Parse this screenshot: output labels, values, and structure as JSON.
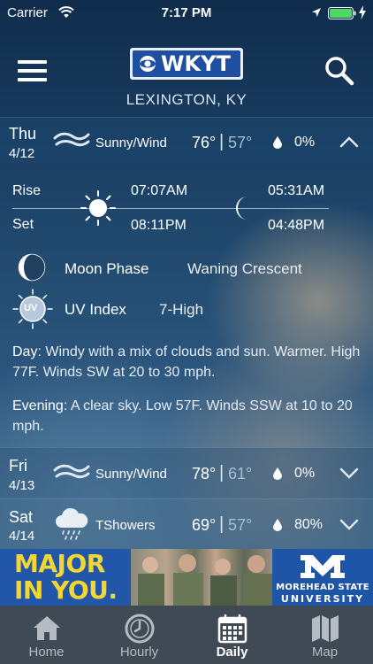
{
  "status_bar": {
    "carrier": "Carrier",
    "time": "7:17 PM",
    "battery_color": "#4cd964"
  },
  "header": {
    "logo_text": "WKYT",
    "location": "LEXINGTON, KY",
    "menu_icon": "hamburger-menu-icon",
    "search_icon": "search-icon"
  },
  "days": [
    {
      "name": "Thu",
      "date": "4/12",
      "condition": "Sunny/Wind",
      "icon": "wind-icon",
      "high": "76°",
      "separator": "|",
      "low": "57°",
      "precip": "0%",
      "expanded": true
    },
    {
      "name": "Fri",
      "date": "4/13",
      "condition": "Sunny/Wind",
      "icon": "wind-icon",
      "high": "78°",
      "separator": "|",
      "low": "61°",
      "precip": "0%",
      "expanded": false
    },
    {
      "name": "Sat",
      "date": "4/14",
      "condition": "TShowers",
      "icon": "rain-cloud-icon",
      "high": "69°",
      "separator": "|",
      "low": "57°",
      "precip": "80%",
      "expanded": false
    }
  ],
  "details": {
    "rise_label": "Rise",
    "set_label": "Set",
    "sunrise": "07:07AM",
    "sunset": "08:11PM",
    "moonrise": "05:31AM",
    "moonset": "04:48PM",
    "moon_phase_label": "Moon Phase",
    "moon_phase_value": "Waning Crescent",
    "uv_label": "UV Index",
    "uv_value": "7-High",
    "uv_badge": "UV",
    "day_label": "Day",
    "day_text": ": Windy with a mix of clouds and sun. Warmer. High 77F. Winds SW at 20 to 30 mph.",
    "evening_label": "Evening",
    "evening_text": ": A clear sky. Low 57F. Winds SSW at 10 to 20 mph."
  },
  "ad": {
    "headline_line1": "MAJOR",
    "headline_line2": "IN YOU.",
    "university_line1": "MOREHEAD STATE",
    "university_line2": "UNIVERSITY",
    "headline_color": "#f4d633",
    "background_color": "#2156a8"
  },
  "tabs": [
    {
      "label": "Home",
      "icon": "home-icon",
      "active": false
    },
    {
      "label": "Hourly",
      "icon": "clock-icon",
      "active": false
    },
    {
      "label": "Daily",
      "icon": "calendar-icon",
      "active": true
    },
    {
      "label": "Map",
      "icon": "map-icon",
      "active": false
    }
  ]
}
